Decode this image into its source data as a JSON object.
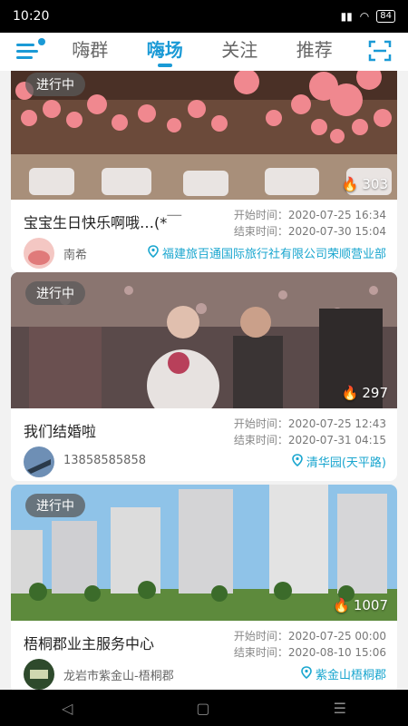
{
  "status": {
    "time": "10:20",
    "battery": "84"
  },
  "tabs": [
    {
      "label": "嗨群"
    },
    {
      "label": "嗨场"
    },
    {
      "label": "关注"
    },
    {
      "label": "推荐"
    }
  ],
  "colors": {
    "accent": "#1a9ad6",
    "location": "#1aa6cf"
  },
  "cards": [
    {
      "badge": "进行中",
      "hot": "303",
      "title": "宝宝生日快乐啊哦…(*￣",
      "start_label": "开始时间：",
      "start": "2020-07-25 16:34",
      "end_label": "结束时间：",
      "end": "2020-07-30 15:04",
      "author": "南希",
      "location": "福建旅百通国际旅行社有限公司荣顺营业部"
    },
    {
      "badge": "进行中",
      "hot": "297",
      "title": "我们结婚啦",
      "start_label": "开始时间：",
      "start": "2020-07-25 12:43",
      "end_label": "结束时间：",
      "end": "2020-07-31 04:15",
      "author": "13858585858",
      "location": "清华园(天平路)"
    },
    {
      "badge": "进行中",
      "hot": "1007",
      "title": "梧桐郡业主服务中心",
      "start_label": "开始时间：",
      "start": "2020-07-25 00:00",
      "end_label": "结束时间：",
      "end": "2020-08-10 15:06",
      "author": "龙岩市紫金山-梧桐郡",
      "location": "紫金山梧桐郡"
    }
  ]
}
